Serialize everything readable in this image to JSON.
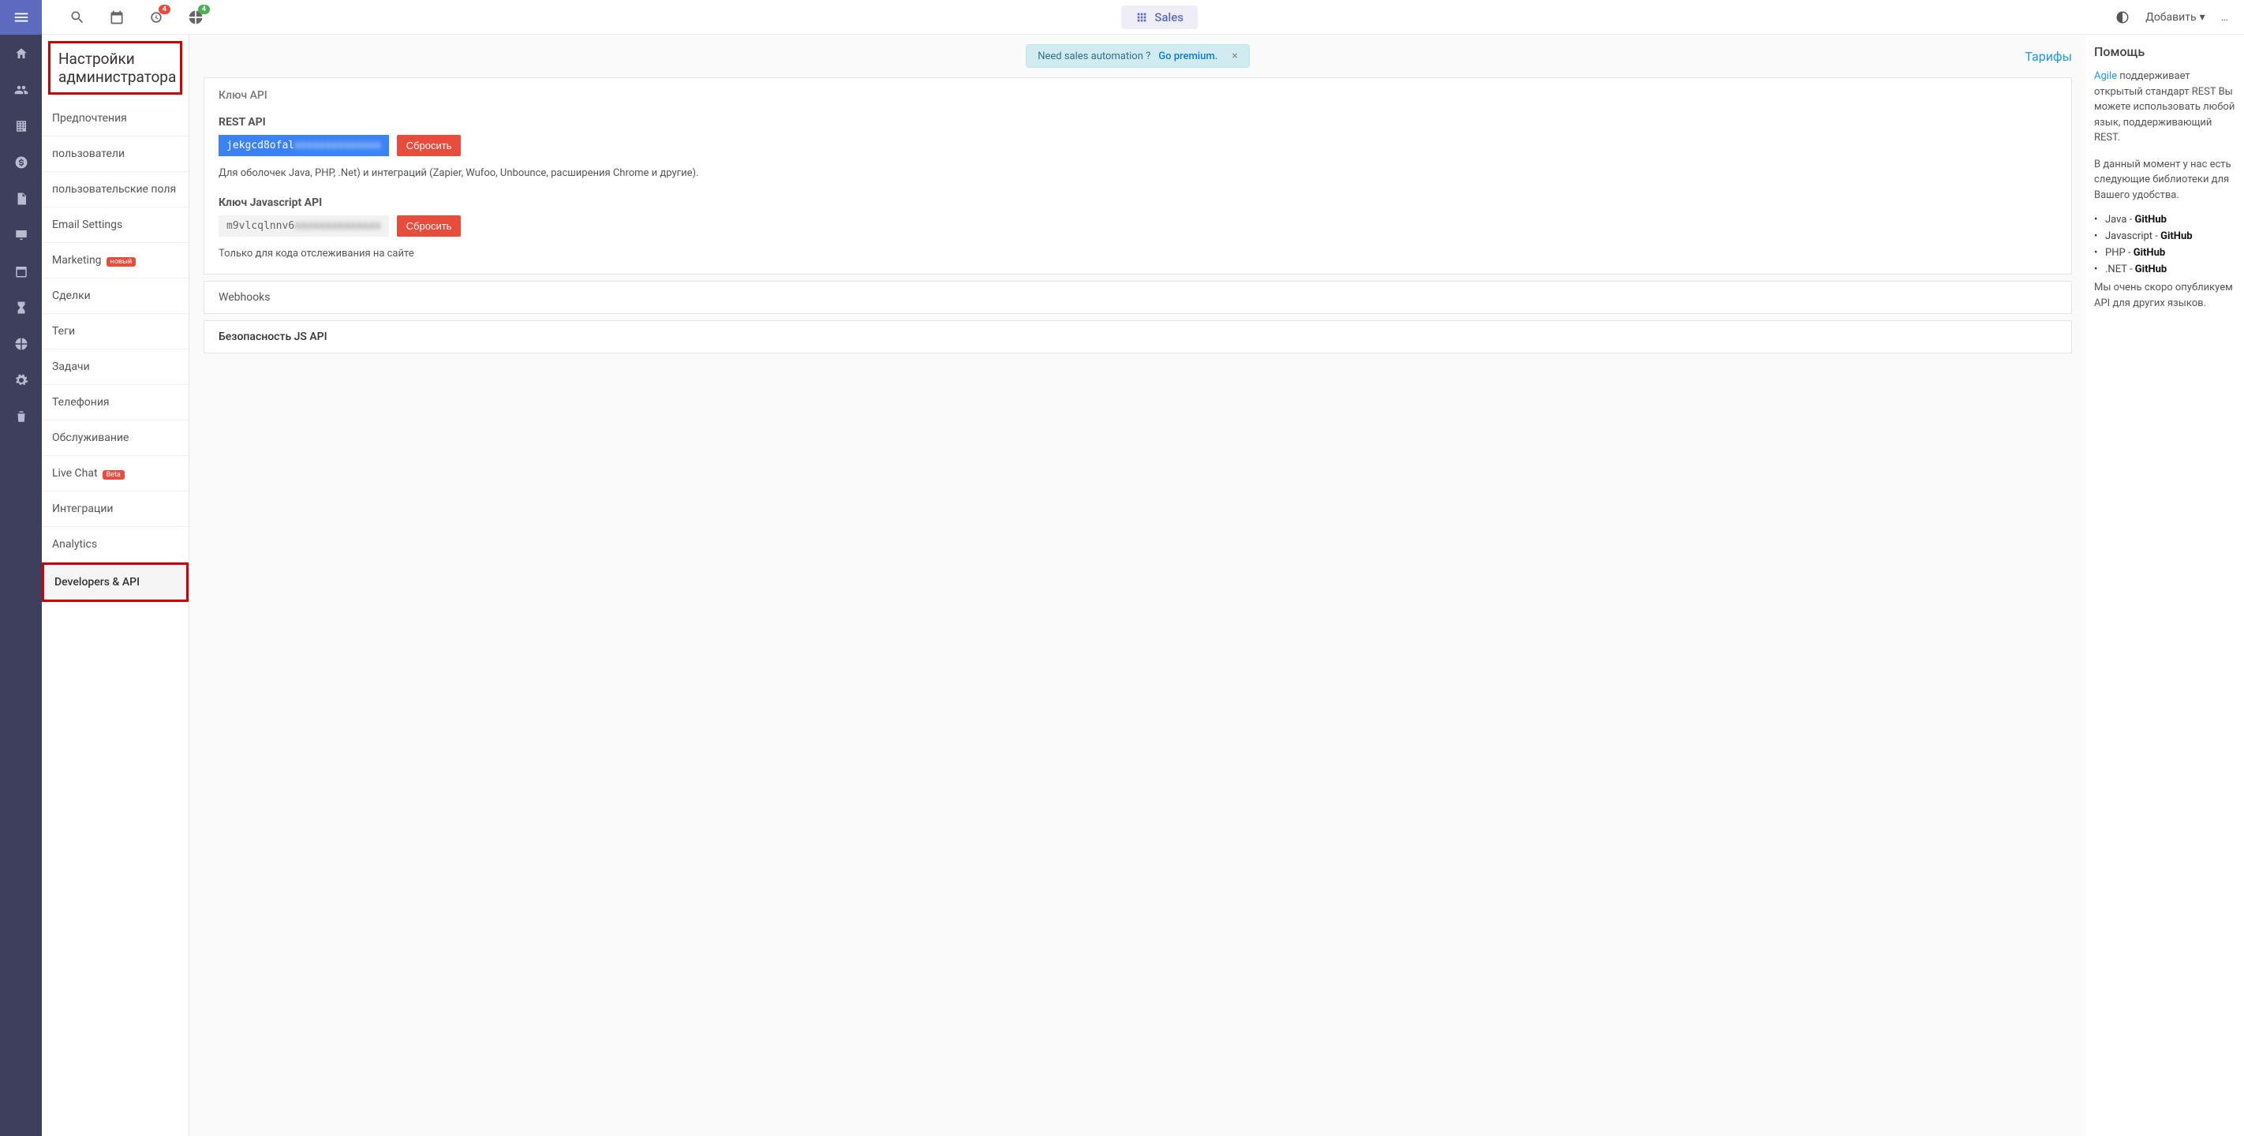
{
  "top": {
    "badge1": "4",
    "badge2": "4",
    "sales": "Sales",
    "add": "Добавить",
    "more": "…"
  },
  "sidebar": {
    "title": "Настройки администратора",
    "items": [
      {
        "label": "Предпочтения"
      },
      {
        "label": "пользователи"
      },
      {
        "label": "пользовательские поля"
      },
      {
        "label": "Email Settings"
      },
      {
        "label": "Marketing",
        "badge": "новый"
      },
      {
        "label": "Сделки"
      },
      {
        "label": "Теги"
      },
      {
        "label": "Задачи"
      },
      {
        "label": "Телефония"
      },
      {
        "label": "Обслуживание"
      },
      {
        "label": "Live Chat",
        "badge": "Beta"
      },
      {
        "label": "Интеграции"
      },
      {
        "label": "Analytics"
      },
      {
        "label": "Developers & API"
      }
    ]
  },
  "promo": {
    "text": "Need sales automation ?",
    "link": "Go premium.",
    "close": "×"
  },
  "tariffs": "Тарифы",
  "card": {
    "title": "Ключ API",
    "rest_label": "REST API",
    "rest_key_visible": "jekgcd8ofal",
    "rest_key_blur": "xxxxxxxxxxxxxx",
    "reset": "Сбросить",
    "rest_desc": "Для оболочек Java, PHP, .Net) и интеграций (Zapier, Wufoo, Unbounce, расширения Chrome и другие).",
    "js_label": "Ключ Javascript API",
    "js_key_visible": "m9vlcqlnnv6",
    "js_key_blur": "xxxxxxxxxxxxxx",
    "js_desc": "Только для кода отслеживания на сайте"
  },
  "collapsed": {
    "webhooks": "Webhooks",
    "jssec": "Безопасность JS API"
  },
  "help": {
    "title": "Помощь",
    "p1a": "Agile ",
    "p1b": "поддерживает открытый стандарт REST Вы можете использовать любой язык, поддерживающий REST.",
    "p2": "В данный момент у нас есть следующие библиотеки для Вашего удобства.",
    "libs": [
      {
        "lang": "Java",
        "gh": "GitHub"
      },
      {
        "lang": "Javascript",
        "gh": "GitHub"
      },
      {
        "lang": "PHP",
        "gh": "GitHub"
      },
      {
        "lang": ".NET",
        "gh": "GitHub"
      }
    ],
    "p3": "Мы очень скоро опубликуем API для других языков."
  }
}
